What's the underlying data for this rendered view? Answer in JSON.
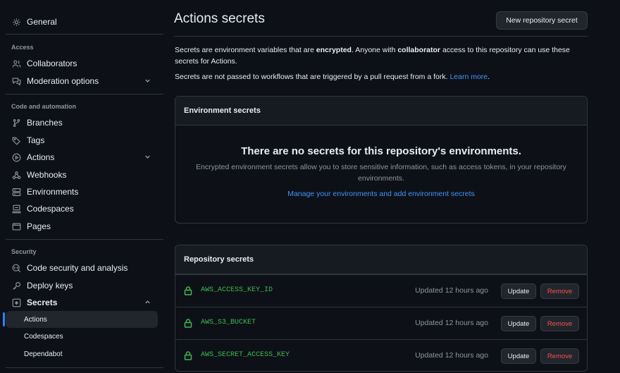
{
  "sidebar": {
    "general": "General",
    "sections": {
      "access": "Access",
      "code_automation": "Code and automation",
      "security": "Security"
    },
    "items": {
      "collaborators": "Collaborators",
      "moderation": "Moderation options",
      "branches": "Branches",
      "tags": "Tags",
      "actions": "Actions",
      "webhooks": "Webhooks",
      "environments": "Environments",
      "codespaces": "Codespaces",
      "pages": "Pages",
      "code_security": "Code security and analysis",
      "deploy_keys": "Deploy keys",
      "secrets": "Secrets"
    },
    "secrets_sub": [
      "Actions",
      "Codespaces",
      "Dependabot"
    ]
  },
  "header": {
    "title": "Actions secrets",
    "new_button": "New repository secret"
  },
  "description": {
    "p1_a": "Secrets are environment variables that are ",
    "p1_b": "encrypted",
    "p1_c": ". Anyone with ",
    "p1_d": "collaborator",
    "p1_e": " access to this repository can use these secrets for Actions.",
    "p2": "Secrets are not passed to workflows that are triggered by a pull request from a fork. ",
    "p2_link": "Learn more",
    "p2_end": "."
  },
  "environment_secrets": {
    "header": "Environment secrets",
    "empty_title": "There are no secrets for this repository's environments.",
    "empty_desc": "Encrypted environment secrets allow you to store sensitive information, such as access tokens, in your repository environments.",
    "link": "Manage your environments and add environment secrets"
  },
  "repository_secrets": {
    "header": "Repository secrets",
    "rows": [
      {
        "name": "AWS_ACCESS_KEY_ID",
        "updated": "Updated 12 hours ago",
        "update": "Update",
        "remove": "Remove"
      },
      {
        "name": "AWS_S3_BUCKET",
        "updated": "Updated 12 hours ago",
        "update": "Update",
        "remove": "Remove"
      },
      {
        "name": "AWS_SECRET_ACCESS_KEY",
        "updated": "Updated 12 hours ago",
        "update": "Update",
        "remove": "Remove"
      }
    ]
  },
  "colors": {
    "background": "#0d1117",
    "accent": "#2f81f7",
    "secret_green": "#3fb950",
    "danger": "#f85149"
  }
}
